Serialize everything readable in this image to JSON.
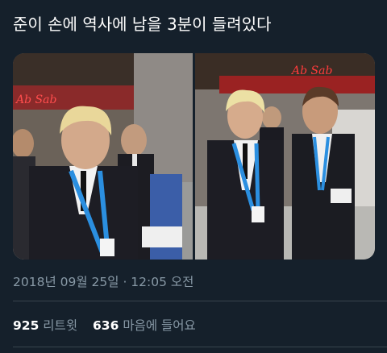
{
  "tweet": {
    "text": "준이 손에 역사에 남을 3분이 들려있다",
    "timestamp": "2018년 09월 25일 · 12:05 오전"
  },
  "stats": {
    "retweets_count": "925",
    "retweets_label": "리트윗",
    "likes_count": "636",
    "likes_label": "마음에 들어요"
  },
  "media": {
    "photos": [
      {
        "description": "photo-left",
        "sign_text": "Ab Sab"
      },
      {
        "description": "photo-right",
        "sign_text": "Ab Sab"
      }
    ]
  },
  "colors": {
    "background": "#15202b",
    "text_primary": "#ffffff",
    "text_secondary": "#8899a6",
    "divider": "#38444d",
    "lanyard_blue": "#2b8fe0"
  }
}
